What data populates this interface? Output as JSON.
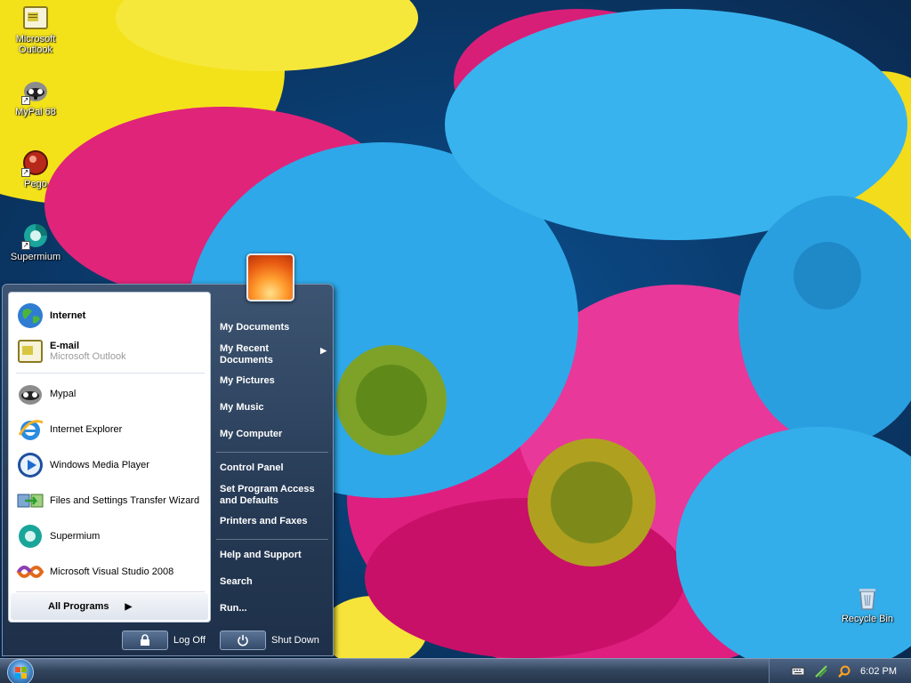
{
  "desktop": {
    "icons": [
      {
        "label": "Microsoft Outlook",
        "icon": "outlook-icon"
      },
      {
        "label": "MyPal 68",
        "icon": "mypal-icon"
      },
      {
        "label": "Pego",
        "icon": "pego-icon"
      },
      {
        "label": "Supermium",
        "icon": "supermium-icon"
      },
      {
        "label": "Recycle Bin",
        "icon": "recycle-bin-icon"
      }
    ]
  },
  "start_menu": {
    "pinned": [
      {
        "label": "Internet",
        "icon": "globe-icon"
      },
      {
        "label": "E-mail",
        "sub": "Microsoft Outlook",
        "icon": "outlook-icon"
      }
    ],
    "recent": [
      {
        "label": "Mypal",
        "icon": "mypal-icon"
      },
      {
        "label": "Internet Explorer",
        "icon": "ie-icon"
      },
      {
        "label": "Windows Media Player",
        "icon": "media-player-icon"
      },
      {
        "label": "Files and Settings Transfer Wizard",
        "icon": "transfer-wizard-icon"
      },
      {
        "label": "Supermium",
        "icon": "supermium-icon"
      },
      {
        "label": "Microsoft Visual Studio 2008",
        "icon": "visual-studio-icon"
      }
    ],
    "all_programs": "All Programs",
    "right": [
      {
        "label": "My Documents"
      },
      {
        "label": "My Recent\nDocuments",
        "submenu": true
      },
      {
        "label": "My Pictures"
      },
      {
        "label": "My Music"
      },
      {
        "label": "My Computer"
      },
      {
        "label": "Control Panel"
      },
      {
        "label": "Set Program Access\nand Defaults"
      },
      {
        "label": "Printers and Faxes"
      },
      {
        "label": "Help and Support"
      },
      {
        "label": "Search"
      },
      {
        "label": "Run..."
      }
    ],
    "log_off": "Log Off",
    "shut_down": "Shut Down"
  },
  "taskbar": {
    "clock": "6:02 PM",
    "tray_icons": [
      "keyboard-icon",
      "network-icon",
      "search-icon"
    ]
  },
  "colors": {
    "taskbar": "#2d3f57",
    "start_menu_right": "#2b4060"
  }
}
